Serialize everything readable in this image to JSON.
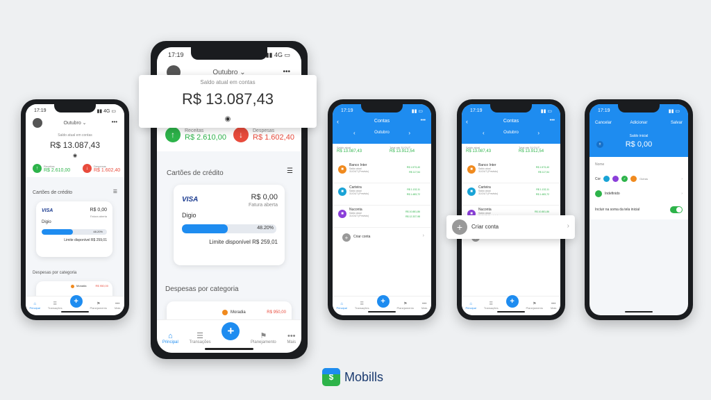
{
  "status": {
    "time": "17:19",
    "net": "4G"
  },
  "home": {
    "month": "Outubro",
    "balance_label": "Saldo atual em contas",
    "balance": "R$ 13.087,43",
    "income_label": "Receitas",
    "income": "R$ 2.610,00",
    "expense_label": "Despesas",
    "expense": "R$ 1.602,40",
    "cards_title": "Cartões de crédito",
    "card": {
      "brand": "VISA",
      "amount": "R$ 0,00",
      "status": "Fatura aberta",
      "name": "Digio",
      "percent": "48.20%",
      "progress": 0.482,
      "limit": "Limite disponível R$ 259,01"
    },
    "cat_title": "Despesas por categoria",
    "cat_name": "Moradia",
    "cat_value": "R$ 950,00"
  },
  "tabs": {
    "home": "Principal",
    "trans": "Transações",
    "plan": "Planejamento",
    "more": "Mais"
  },
  "accounts": {
    "title": "Contas",
    "month": "Outubro",
    "saldo_label": "Saldo atual",
    "saldo": "R$ 13.087,43",
    "total_label": "Total até 31/OUT",
    "total": "R$ 13.912,54",
    "items": [
      {
        "name": "Banco Inter",
        "l1": "Saldo atual",
        "l2": "31/OUT (Previsto)",
        "v1": "R$ 1.573,40",
        "v2": "R$ 117,54"
      },
      {
        "name": "Carteira",
        "l1": "Saldo atual",
        "l2": "31/OUT (Previsto)",
        "v1": "R$ 1.132,11",
        "v2": "R$ 1.483,72"
      },
      {
        "name": "Nuconta",
        "l1": "Saldo atual",
        "l2": "31/OUT (Previsto)",
        "v1": "R$ 10.881,86",
        "v2": "R$ 12.337,98"
      }
    ],
    "create": "Criar conta"
  },
  "form": {
    "cancel": "Cancelar",
    "title": "Adicionar",
    "save": "Salvar",
    "init_label": "Saldo inicial",
    "init": "R$ 0,00",
    "name_label": "Nome",
    "color_label": "Cor",
    "more": "Outras",
    "type": "Indefinido",
    "include": "Incluir na soma da tela inicial"
  },
  "brand": {
    "name": "Mobills"
  },
  "colors": {
    "blue": "#1e8cf0",
    "green": "#2db34a",
    "red": "#e84b3c",
    "orange": "#f08a1e",
    "teal": "#19a3d6",
    "purple": "#8b3fd9"
  }
}
